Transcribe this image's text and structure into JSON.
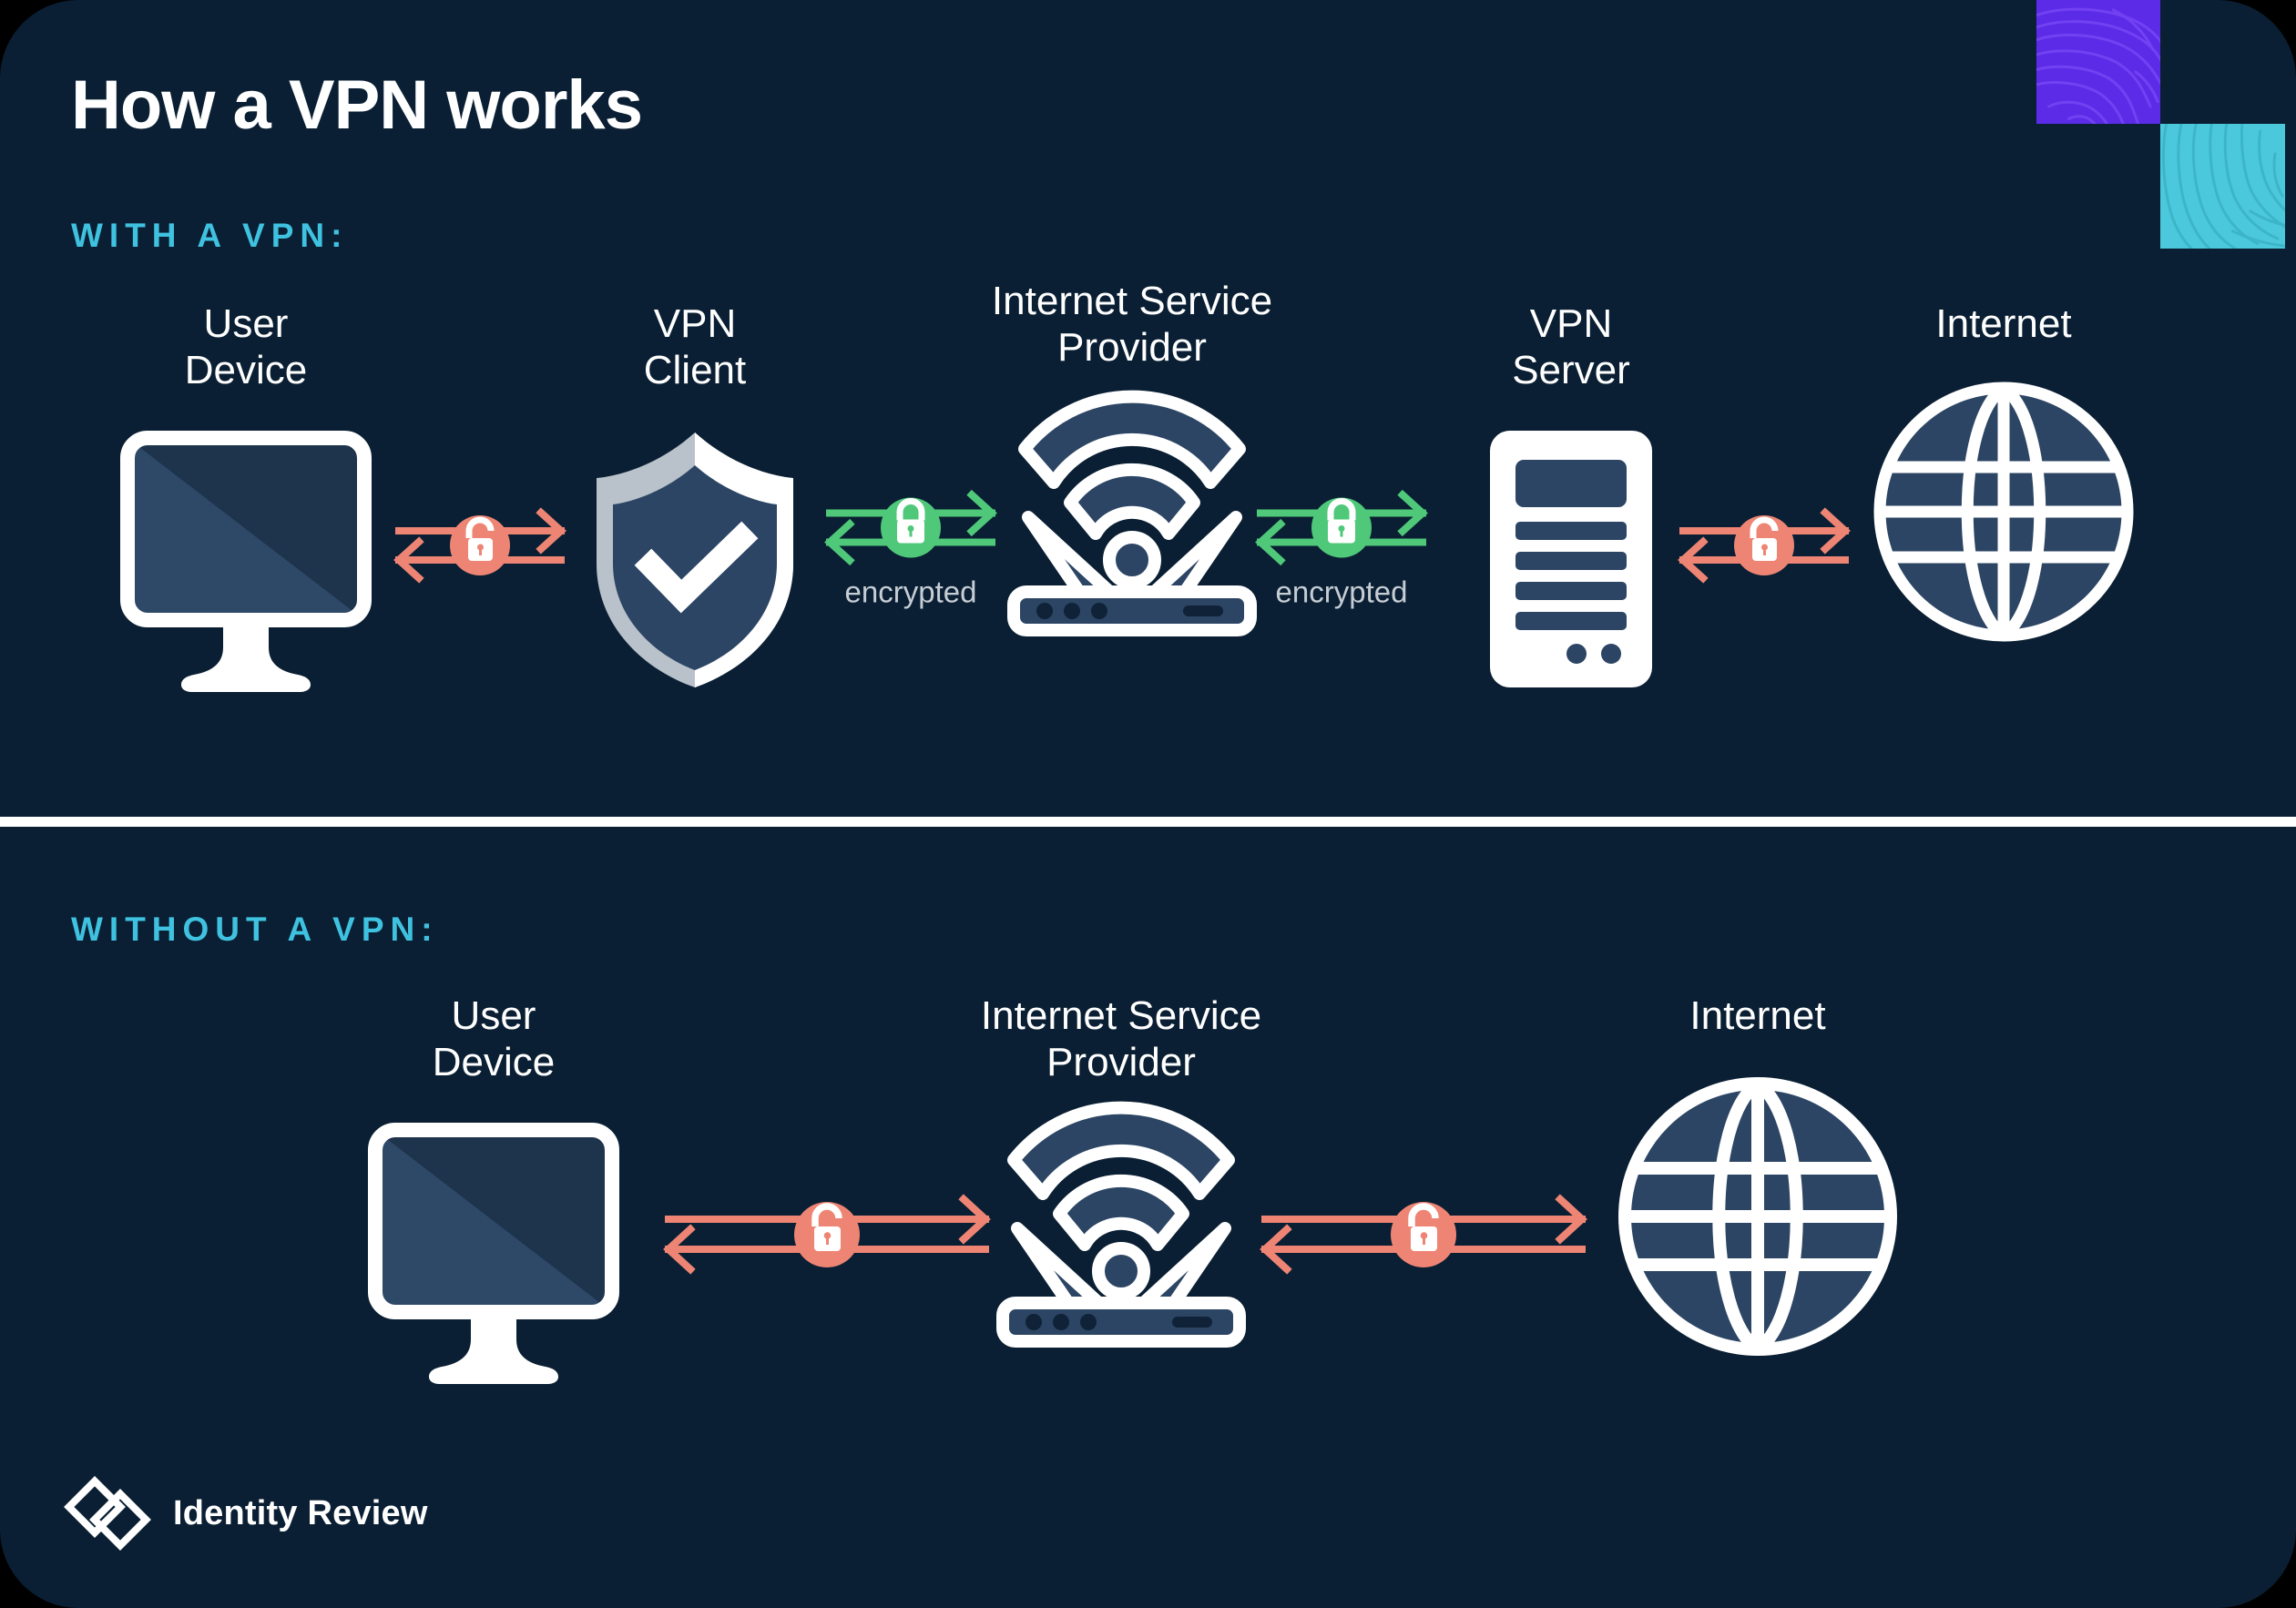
{
  "theme": {
    "background": "#0A1F33",
    "accent_cyan": "#3FC2E0",
    "accent_purple": "#5B2BE8",
    "accent_teal": "#4BC8DC",
    "white": "#FFFFFF",
    "device_fill": "#2C4564",
    "device_fill_light": "#35506F",
    "lock_open_color": "#EE8574",
    "lock_closed_color": "#4FC879",
    "encrypted_text_color": "#C6CDD4",
    "shield_edge": "#B9C2CB"
  },
  "header": {
    "title": "How a VPN works"
  },
  "sections": [
    {
      "id": "with-vpn",
      "heading": "WITH A VPN:",
      "nodes": [
        {
          "id": "user-device",
          "label": "User\nDevice",
          "icon": "monitor-icon"
        },
        {
          "id": "vpn-client",
          "label": "VPN\nClient",
          "icon": "shield-check-icon"
        },
        {
          "id": "isp",
          "label": "Internet Service\nProvider",
          "icon": "wifi-router-icon"
        },
        {
          "id": "vpn-server",
          "label": "VPN\nServer",
          "icon": "server-tower-icon"
        },
        {
          "id": "internet",
          "label": "Internet",
          "icon": "globe-icon"
        }
      ],
      "connectors": [
        {
          "id": "conn-1",
          "state": "unencrypted",
          "icon": "unlocked-padlock-icon",
          "color": "#EE8574",
          "label": ""
        },
        {
          "id": "conn-2",
          "state": "encrypted",
          "icon": "locked-padlock-icon",
          "color": "#4FC879",
          "label": "encrypted"
        },
        {
          "id": "conn-3",
          "state": "encrypted",
          "icon": "locked-padlock-icon",
          "color": "#4FC879",
          "label": "encrypted"
        },
        {
          "id": "conn-4",
          "state": "unencrypted",
          "icon": "unlocked-padlock-icon",
          "color": "#EE8574",
          "label": ""
        }
      ]
    },
    {
      "id": "without-vpn",
      "heading": "WITHOUT A VPN:",
      "nodes": [
        {
          "id": "user-device-2",
          "label": "User\nDevice",
          "icon": "monitor-icon"
        },
        {
          "id": "isp-2",
          "label": "Internet Service\nProvider",
          "icon": "wifi-router-icon"
        },
        {
          "id": "internet-2",
          "label": "Internet",
          "icon": "globe-icon"
        }
      ],
      "connectors": [
        {
          "id": "conn-b1",
          "state": "unencrypted",
          "icon": "unlocked-padlock-icon",
          "color": "#EE8574",
          "label": ""
        },
        {
          "id": "conn-b2",
          "state": "unencrypted",
          "icon": "unlocked-padlock-icon",
          "color": "#EE8574",
          "label": ""
        }
      ]
    }
  ],
  "footer": {
    "logo_text": "Identity Review",
    "logo_icon": "double-diamond-logo-icon"
  }
}
